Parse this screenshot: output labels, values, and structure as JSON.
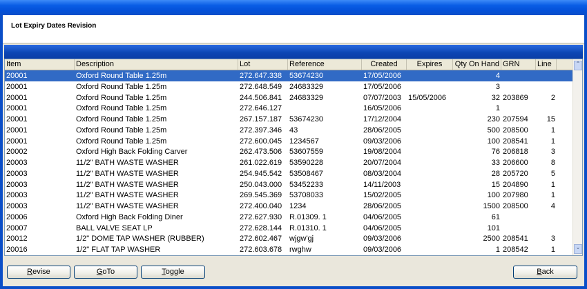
{
  "header": {
    "title": "Lot Expiry Dates Revision"
  },
  "grid": {
    "columns": [
      "Item",
      "Description",
      "Lot",
      "Reference",
      "Created",
      "Expires",
      "Qty On Hand",
      "GRN",
      "Line"
    ],
    "selected_row": 0,
    "rows": [
      [
        "20001",
        "Oxford Round Table 1.25m",
        "272.647.338",
        "53674230",
        "17/05/2006",
        "",
        "4",
        "",
        ""
      ],
      [
        "20001",
        "Oxford Round Table 1.25m",
        "272.648.549",
        "24683329",
        "17/05/2006",
        "",
        "3",
        "",
        ""
      ],
      [
        "20001",
        "Oxford Round Table 1.25m",
        "244.506.841",
        "24683329",
        "07/07/2003",
        "15/05/2006",
        "32",
        "203869",
        "2"
      ],
      [
        "20001",
        "Oxford Round Table 1.25m",
        "272.646.127",
        "",
        "16/05/2006",
        "",
        "1",
        "",
        ""
      ],
      [
        "20001",
        "Oxford Round Table 1.25m",
        "267.157.187",
        "53674230",
        "17/12/2004",
        "",
        "230",
        "207594",
        "15"
      ],
      [
        "20001",
        "Oxford Round Table 1.25m",
        "272.397.346",
        "43",
        "28/06/2005",
        "",
        "500",
        "208500",
        "1"
      ],
      [
        "20001",
        "Oxford Round Table 1.25m",
        "272.600.045",
        "1234567",
        "09/03/2006",
        "",
        "100",
        "208541",
        "1"
      ],
      [
        "20002",
        "Oxford High Back Folding Carver",
        "262.473.506",
        "53607559",
        "19/08/2004",
        "",
        "76",
        "206818",
        "3"
      ],
      [
        "20003",
        "11/2\" BATH WASTE WASHER",
        "261.022.619",
        "53590228",
        "20/07/2004",
        "",
        "33",
        "206600",
        "8"
      ],
      [
        "20003",
        "11/2\" BATH WASTE WASHER",
        "254.945.542",
        "53508467",
        "08/03/2004",
        "",
        "28",
        "205720",
        "5"
      ],
      [
        "20003",
        "11/2\" BATH WASTE WASHER",
        "250.043.000",
        "53452233",
        "14/11/2003",
        "",
        "15",
        "204890",
        "1"
      ],
      [
        "20003",
        "11/2\" BATH WASTE WASHER",
        "269.545.369",
        "53708033",
        "15/02/2005",
        "",
        "100",
        "207980",
        "1"
      ],
      [
        "20003",
        "11/2\" BATH WASTE WASHER",
        "272.400.040",
        "1234",
        "28/06/2005",
        "",
        "1500",
        "208500",
        "4"
      ],
      [
        "20006",
        "Oxford High Back Folding Diner",
        "272.627.930",
        "R.01309.  1",
        "04/06/2005",
        "",
        "61",
        "",
        ""
      ],
      [
        "20007",
        "BALL VALVE SEAT LP",
        "272.628.144",
        "R.01310.  1",
        "04/06/2005",
        "",
        "101",
        "",
        ""
      ],
      [
        "20012",
        "1/2\" DOME TAP WASHER (RUBBER)",
        "272.602.467",
        "wjgw'gj",
        "09/03/2006",
        "",
        "2500",
        "208541",
        "3"
      ],
      [
        "20016",
        "1/2\" FLAT TAP WASHER",
        "272.603.678",
        "rwghw",
        "09/03/2006",
        "",
        "1",
        "208542",
        "1"
      ]
    ]
  },
  "scrollbar": {
    "up_glyph": "⌃",
    "down_glyph": "⌄"
  },
  "buttons": {
    "revise": {
      "mnemonic": "R",
      "rest": "evise"
    },
    "goto": {
      "mnemonic": "G",
      "rest": "oTo"
    },
    "toggle": {
      "mnemonic": "T",
      "rest": "oggle"
    },
    "back": {
      "mnemonic": "B",
      "rest": "ack"
    }
  },
  "colors": {
    "title_bar": "#0450d8",
    "selection": "#316ac5",
    "grid_caption": "#0d47b5"
  }
}
